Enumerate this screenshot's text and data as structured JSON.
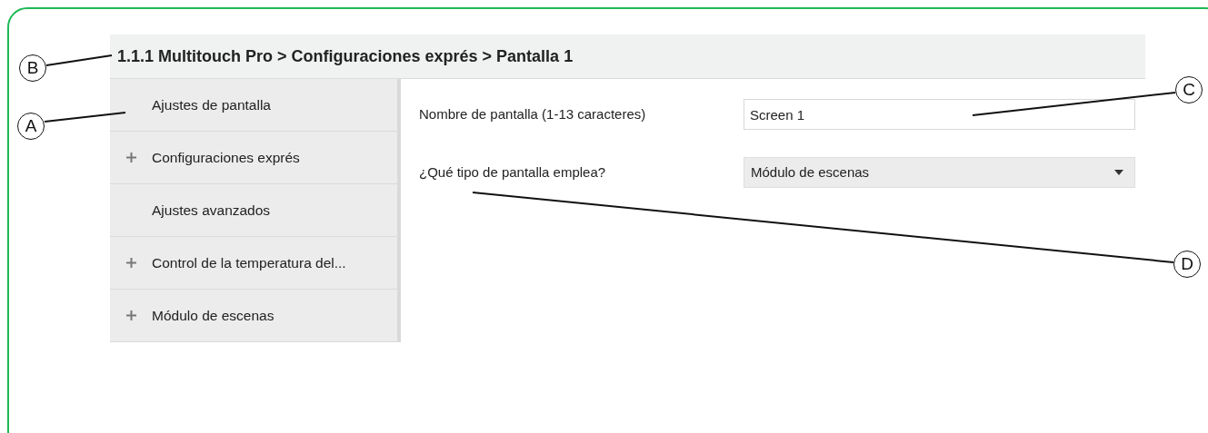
{
  "breadcrumb": "1.1.1 Multitouch Pro > Configuraciones exprés > Pantalla 1",
  "sidebar": {
    "items": [
      {
        "label": "Ajustes de pantalla",
        "expandable": false
      },
      {
        "label": "Configuraciones exprés",
        "expandable": true
      },
      {
        "label": "Ajustes avanzados",
        "expandable": false
      },
      {
        "label": "Control de la temperatura del...",
        "expandable": true
      },
      {
        "label": "Módulo de escenas",
        "expandable": true
      }
    ]
  },
  "form": {
    "rows": [
      {
        "kind": "text",
        "label": "Nombre de pantalla (1-13 caracteres)",
        "value": "Screen 1"
      },
      {
        "kind": "select",
        "label": "¿Qué tipo de pantalla emplea?",
        "value": "Módulo de escenas"
      }
    ]
  },
  "callouts": [
    {
      "letter": "B"
    },
    {
      "letter": "A"
    },
    {
      "letter": "C"
    },
    {
      "letter": "D"
    }
  ]
}
